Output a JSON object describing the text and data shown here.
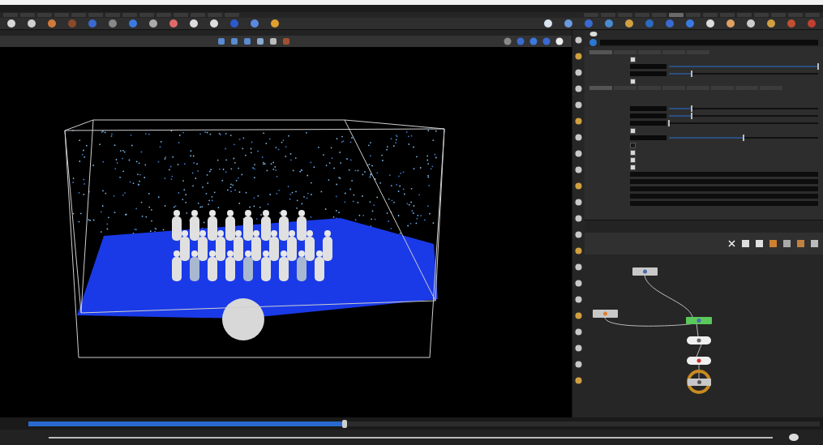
{
  "shelf_tabs": [
    {
      "selected": false
    },
    {
      "selected": false
    },
    {
      "selected": false
    },
    {
      "selected": false
    },
    {
      "selected": false
    },
    {
      "selected": false
    },
    {
      "selected": false
    },
    {
      "selected": false
    },
    {
      "selected": false
    },
    {
      "selected": false
    },
    {
      "selected": false
    },
    {
      "selected": false
    },
    {
      "selected": false
    },
    {
      "selected": false
    },
    {
      "selected": false
    },
    {
      "selected": false
    },
    {
      "selected": false
    },
    {
      "selected": false
    },
    {
      "selected": false
    },
    {
      "selected": true
    },
    {
      "selected": false
    },
    {
      "selected": false
    },
    {
      "selected": false
    },
    {
      "selected": false
    },
    {
      "selected": false
    },
    {
      "selected": false
    },
    {
      "selected": false
    },
    {
      "selected": false
    }
  ],
  "param_tabs": [
    {
      "selected": true
    },
    {
      "selected": false
    },
    {
      "selected": false
    },
    {
      "selected": false
    },
    {
      "selected": false
    }
  ],
  "param_subtabs": [
    {
      "selected": true
    },
    {
      "selected": false
    },
    {
      "selected": false
    },
    {
      "selected": false
    },
    {
      "selected": false
    },
    {
      "selected": false
    },
    {
      "selected": false
    },
    {
      "selected": false
    }
  ],
  "parameters": [
    {
      "kind": "checkbox",
      "checked": true
    },
    {
      "kind": "slider",
      "level": 1.0
    },
    {
      "kind": "slider",
      "level": 0.15
    },
    {
      "kind": "checkbox",
      "checked": true
    },
    {
      "kind": "gap"
    },
    {
      "kind": "slider",
      "level": 0.15
    },
    {
      "kind": "slider",
      "level": 0.15
    },
    {
      "kind": "slider",
      "level": 0.0
    },
    {
      "kind": "checkbox",
      "checked": true
    },
    {
      "kind": "slider",
      "level": 0.5
    },
    {
      "kind": "checkbox",
      "checked": false
    },
    {
      "kind": "checkbox",
      "checked": true
    },
    {
      "kind": "checkbox",
      "checked": true
    },
    {
      "kind": "checkbox",
      "checked": true
    },
    {
      "kind": "field"
    },
    {
      "kind": "field"
    },
    {
      "kind": "field"
    },
    {
      "kind": "field"
    },
    {
      "kind": "field"
    }
  ],
  "timeline": {
    "level": 0.4
  }
}
